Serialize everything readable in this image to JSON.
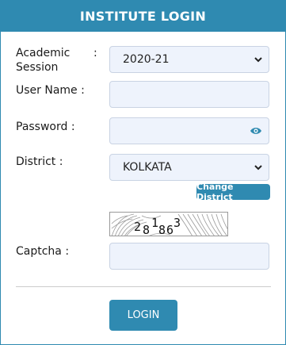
{
  "header": {
    "title": "INSTITUTE LOGIN"
  },
  "form": {
    "academic_session": {
      "label": "Academic Session",
      "value": "2020-21"
    },
    "user_name": {
      "label": "User Name :",
      "value": ""
    },
    "password": {
      "label": "Password :",
      "value": ""
    },
    "district": {
      "label": "District :",
      "value": "KOLKATA"
    },
    "change_district": "Change District",
    "captcha": {
      "label": "Captcha :",
      "value": "",
      "image_text": "2816863"
    },
    "colon": ":"
  },
  "login_button": "LOGIN",
  "colors": {
    "accent": "#2f8ab1",
    "field_bg": "#eef3fc"
  },
  "icons": {
    "password_toggle": "eye-icon",
    "select_arrow": "chevron-down-icon"
  }
}
